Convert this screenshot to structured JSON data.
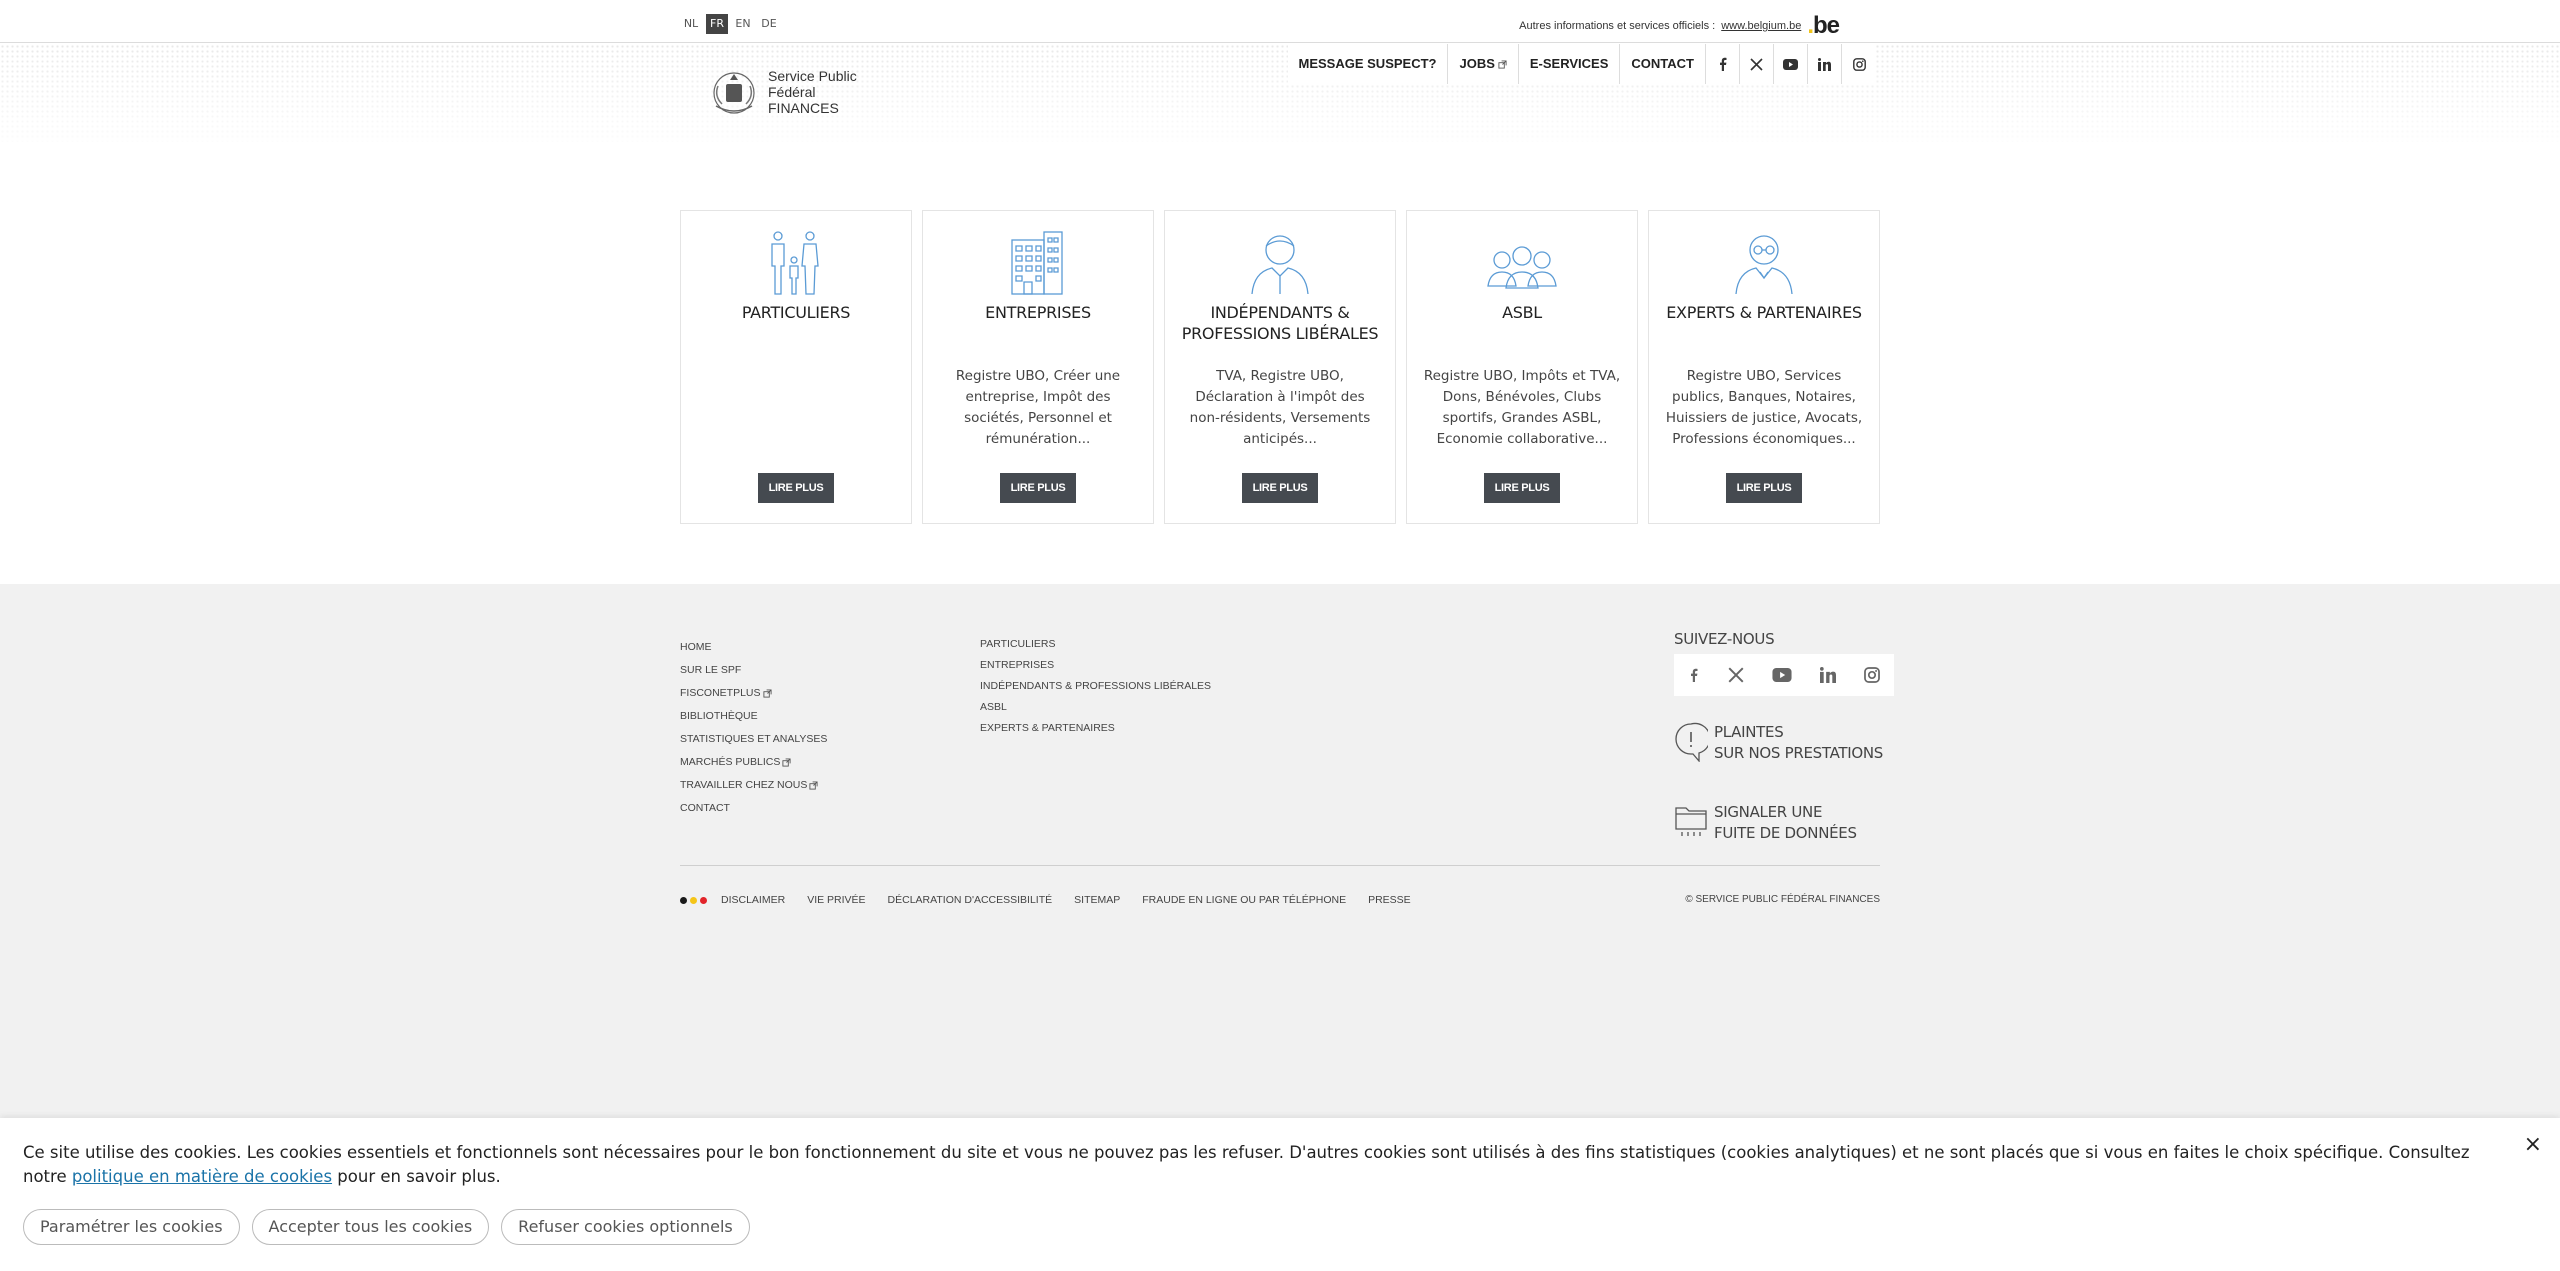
{
  "topbar": {
    "languages": [
      "NL",
      "FR",
      "EN",
      "DE"
    ],
    "active_language": "FR",
    "official_text": "Autres informations et services officiels :",
    "official_link": "www.belgium.be",
    "be_logo": ".be"
  },
  "brand": {
    "line1": "Service Public",
    "line2": "Fédéral",
    "line3": "FINANCES"
  },
  "nav": {
    "items": [
      "MESSAGE SUSPECT?",
      "JOBS",
      "E-SERVICES",
      "CONTACT"
    ],
    "social_icons": [
      "facebook-icon",
      "x-icon",
      "youtube-icon",
      "linkedin-icon",
      "instagram-icon"
    ]
  },
  "cards": [
    {
      "title": "PARTICULIERS",
      "description": "",
      "button": "LIRE PLUS",
      "icon": "family-icon"
    },
    {
      "title": "ENTREPRISES",
      "description": "Registre UBO, Créer une entreprise, Impôt des sociétés, Personnel et rémunération...",
      "button": "LIRE PLUS",
      "icon": "building-icon"
    },
    {
      "title": "INDÉPENDANTS & PROFESSIONS LIBÉRALES",
      "description": "TVA, Registre UBO, Déclaration à l'impôt des non-résidents, Versements anticipés...",
      "button": "LIRE PLUS",
      "icon": "person-icon"
    },
    {
      "title": "ASBL",
      "description": "Registre UBO, Impôts et TVA, Dons, Bénévoles, Clubs sportifs, Grandes ASBL, Economie collaborative...",
      "button": "LIRE PLUS",
      "icon": "group-icon"
    },
    {
      "title": "EXPERTS & PARTENAIRES",
      "description": "Registre UBO, Services publics, Banques, Notaires, Huissiers de justice, Avocats, Professions économiques...",
      "button": "LIRE PLUS",
      "icon": "expert-icon"
    }
  ],
  "footer": {
    "col1": [
      "HOME",
      "SUR LE SPF",
      "FISCONETPLUS",
      "BIBLIOTHÈQUE",
      "STATISTIQUES ET ANALYSES",
      "MARCHÉS PUBLICS",
      "TRAVAILLER CHEZ NOUS",
      "CONTACT"
    ],
    "col2": [
      "PARTICULIERS",
      "ENTREPRISES",
      "INDÉPENDANTS & PROFESSIONS LIBÉRALES",
      "ASBL",
      "EXPERTS & PARTENAIRES"
    ],
    "follow_title": "SUIVEZ-NOUS",
    "complaints_line1": "PLAINTES",
    "complaints_line2": "SUR NOS PRESTATIONS",
    "leak_line1": "SIGNALER UNE",
    "leak_line2": "FUITE DE DONNÉES",
    "legal": [
      "DISCLAIMER",
      "VIE PRIVÉE",
      "DÉCLARATION D'ACCESSIBILITÉ",
      "SITEMAP",
      "FRAUDE EN LIGNE OU PAR TÉLÉPHONE",
      "PRESSE"
    ],
    "copyright": "© SERVICE PUBLIC FÉDÉRAL FINANCES",
    "flag_colors": [
      "#1a1a1a",
      "#f5c518",
      "#e2242a"
    ]
  },
  "cookie": {
    "message_before": "Ce site utilise des cookies. Les cookies essentiels et fonctionnels sont nécessaires pour le bon fonctionnement du site et vous ne pouvez pas les refuser. D'autres cookies sont utilisés à des fins statistiques (cookies analytiques) et ne sont placés que si vous en faites le choix spécifique. Consultez notre ",
    "link": "politique en matière de cookies",
    "message_after": " pour en savoir plus.",
    "close": "×",
    "buttons": [
      "Paramétrer les cookies",
      "Accepter tous les cookies",
      "Refuser cookies optionnels"
    ]
  },
  "colors": {
    "icon_blue": "#5b9bd5",
    "button_dark": "#454a50",
    "footer_bg": "#f1f1f1",
    "link_blue": "#1a73a8"
  }
}
